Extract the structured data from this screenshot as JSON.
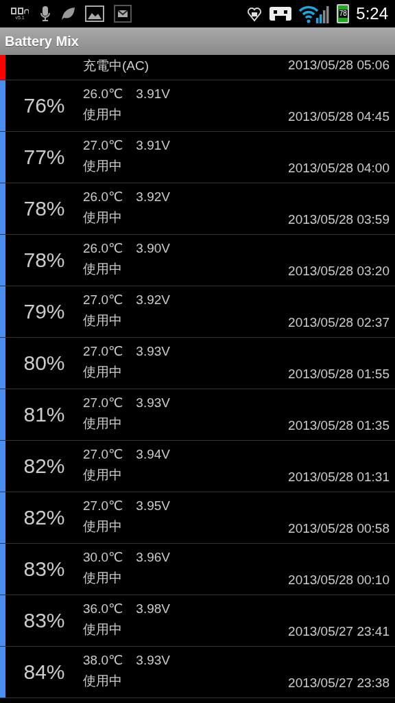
{
  "status_bar": {
    "audio_version": "v5.1",
    "battery_percent": "78",
    "time": "5:24"
  },
  "app_bar": {
    "title": "Battery Mix"
  },
  "history": [
    {
      "kind": "charging",
      "color": "#ff0000",
      "state": "充電中(AC)",
      "date": "2013/05/28 05:06"
    },
    {
      "kind": "discharging",
      "color": "#4a8ff0",
      "percent": "76%",
      "reading": "26.0℃　3.91V",
      "state": "使用中",
      "date": "2013/05/28 04:45"
    },
    {
      "kind": "discharging",
      "color": "#4a8ff0",
      "percent": "77%",
      "reading": "27.0℃　3.91V",
      "state": "使用中",
      "date": "2013/05/28 04:00"
    },
    {
      "kind": "discharging",
      "color": "#4a8ff0",
      "percent": "78%",
      "reading": "26.0℃　3.92V",
      "state": "使用中",
      "date": "2013/05/28 03:59"
    },
    {
      "kind": "discharging",
      "color": "#4a8ff0",
      "percent": "78%",
      "reading": "26.0℃　3.90V",
      "state": "使用中",
      "date": "2013/05/28 03:20"
    },
    {
      "kind": "discharging",
      "color": "#4a8ff0",
      "percent": "79%",
      "reading": "27.0℃　3.92V",
      "state": "使用中",
      "date": "2013/05/28 02:37"
    },
    {
      "kind": "discharging",
      "color": "#4a8ff0",
      "percent": "80%",
      "reading": "27.0℃　3.93V",
      "state": "使用中",
      "date": "2013/05/28 01:55"
    },
    {
      "kind": "discharging",
      "color": "#4a8ff0",
      "percent": "81%",
      "reading": "27.0℃　3.93V",
      "state": "使用中",
      "date": "2013/05/28 01:35"
    },
    {
      "kind": "discharging",
      "color": "#4a8ff0",
      "percent": "82%",
      "reading": "27.0℃　3.94V",
      "state": "使用中",
      "date": "2013/05/28 01:31"
    },
    {
      "kind": "discharging",
      "color": "#4a8ff0",
      "percent": "82%",
      "reading": "27.0℃　3.95V",
      "state": "使用中",
      "date": "2013/05/28 00:58"
    },
    {
      "kind": "discharging",
      "color": "#4a8ff0",
      "percent": "83%",
      "reading": "30.0℃　3.96V",
      "state": "使用中",
      "date": "2013/05/28 00:10"
    },
    {
      "kind": "discharging",
      "color": "#4a8ff0",
      "percent": "83%",
      "reading": "36.0℃　3.98V",
      "state": "使用中",
      "date": "2013/05/27 23:41"
    },
    {
      "kind": "discharging",
      "color": "#4a8ff0",
      "percent": "84%",
      "reading": "38.0℃　3.93V",
      "state": "使用中",
      "date": "2013/05/27 23:38"
    }
  ]
}
